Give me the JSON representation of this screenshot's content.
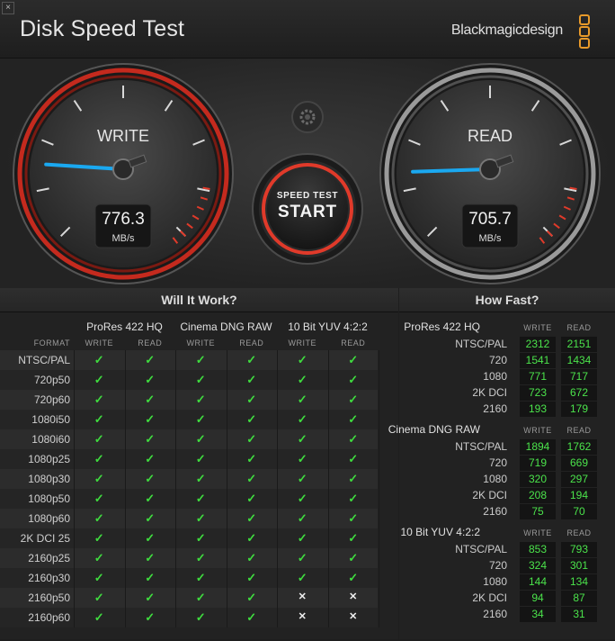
{
  "window": {
    "title": "Disk Speed Test",
    "brand": "Blackmagicdesign",
    "close_glyph": "×"
  },
  "gauges": {
    "write": {
      "label": "WRITE",
      "value": "776.3",
      "unit": "MB/s",
      "needle_fraction": 0.18
    },
    "read": {
      "label": "READ",
      "value": "705.7",
      "unit": "MB/s",
      "needle_fraction": 0.16
    }
  },
  "start_button": {
    "line1": "SPEED TEST",
    "line2": "START"
  },
  "settings_icon": "gear-icon",
  "will_it_work": {
    "title": "Will It Work?",
    "format_header": "FORMAT",
    "codecs": [
      "ProRes 422 HQ",
      "Cinema DNG RAW",
      "10 Bit YUV 4:2:2"
    ],
    "subheaders": [
      "WRITE",
      "READ"
    ],
    "formats": [
      "NTSC/PAL",
      "720p50",
      "720p60",
      "1080i50",
      "1080i60",
      "1080p25",
      "1080p30",
      "1080p50",
      "1080p60",
      "2K DCI 25",
      "2160p25",
      "2160p30",
      "2160p50",
      "2160p60"
    ],
    "matrix": [
      [
        1,
        1,
        1,
        1,
        1,
        1
      ],
      [
        1,
        1,
        1,
        1,
        1,
        1
      ],
      [
        1,
        1,
        1,
        1,
        1,
        1
      ],
      [
        1,
        1,
        1,
        1,
        1,
        1
      ],
      [
        1,
        1,
        1,
        1,
        1,
        1
      ],
      [
        1,
        1,
        1,
        1,
        1,
        1
      ],
      [
        1,
        1,
        1,
        1,
        1,
        1
      ],
      [
        1,
        1,
        1,
        1,
        1,
        1
      ],
      [
        1,
        1,
        1,
        1,
        1,
        1
      ],
      [
        1,
        1,
        1,
        1,
        1,
        1
      ],
      [
        1,
        1,
        1,
        1,
        1,
        1
      ],
      [
        1,
        1,
        1,
        1,
        1,
        1
      ],
      [
        1,
        1,
        1,
        1,
        0,
        0
      ],
      [
        1,
        1,
        1,
        1,
        0,
        0
      ]
    ],
    "check_glyph": "✓",
    "cross_glyph": "✕"
  },
  "how_fast": {
    "title": "How Fast?",
    "subheaders": [
      "WRITE",
      "READ"
    ],
    "groups": [
      {
        "name": "ProRes 422 HQ",
        "rows": [
          {
            "label": "NTSC/PAL",
            "write": "2312",
            "read": "2151"
          },
          {
            "label": "720",
            "write": "1541",
            "read": "1434"
          },
          {
            "label": "1080",
            "write": "771",
            "read": "717"
          },
          {
            "label": "2K DCI",
            "write": "723",
            "read": "672"
          },
          {
            "label": "2160",
            "write": "193",
            "read": "179"
          }
        ]
      },
      {
        "name": "Cinema DNG RAW",
        "rows": [
          {
            "label": "NTSC/PAL",
            "write": "1894",
            "read": "1762"
          },
          {
            "label": "720",
            "write": "719",
            "read": "669"
          },
          {
            "label": "1080",
            "write": "320",
            "read": "297"
          },
          {
            "label": "2K DCI",
            "write": "208",
            "read": "194"
          },
          {
            "label": "2160",
            "write": "75",
            "read": "70"
          }
        ]
      },
      {
        "name": "10 Bit YUV 4:2:2",
        "rows": [
          {
            "label": "NTSC/PAL",
            "write": "853",
            "read": "793"
          },
          {
            "label": "720",
            "write": "324",
            "read": "301"
          },
          {
            "label": "1080",
            "write": "144",
            "read": "134"
          },
          {
            "label": "2K DCI",
            "write": "94",
            "read": "87"
          },
          {
            "label": "2160",
            "write": "34",
            "read": "31"
          }
        ]
      }
    ]
  },
  "colors": {
    "accent_red": "#e03a2a",
    "needle_blue": "#1aa8f0",
    "value_green": "#4be34b",
    "check_green": "#3fdc3f",
    "brand_orange": "#e89a2a"
  }
}
